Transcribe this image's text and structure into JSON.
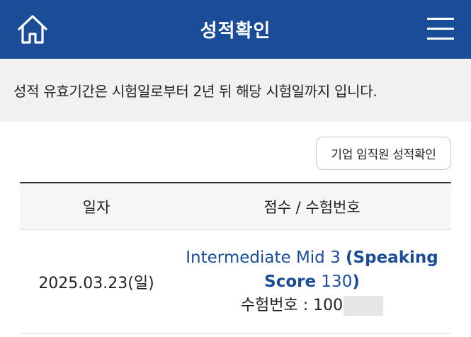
{
  "header": {
    "title": "성적확인",
    "home_icon": "home-icon",
    "menu_icon": "hamburger-menu-icon",
    "bg_color": "#1a4c98"
  },
  "notice": {
    "text": "성적 유효기간은 시험일로부터 2년 뒤 해당 시험일까지 입니다."
  },
  "corporate_button": {
    "label": "기업 임직원 성적확인"
  },
  "table": {
    "headers": [
      "일자",
      "점수 / 수험번호"
    ],
    "rows": [
      {
        "date": "2025.03.23(일)",
        "level": "Intermediate Mid 3",
        "speaking_label_open": "(Speaking",
        "speaking_label_close": "Score",
        "score": "130",
        "score_close": ")",
        "exam_no_label": "수험번호 : ",
        "exam_no_visible": "100"
      }
    ]
  },
  "colors": {
    "accent": "#1a4c98",
    "notice_bg": "#f1f1f1"
  }
}
